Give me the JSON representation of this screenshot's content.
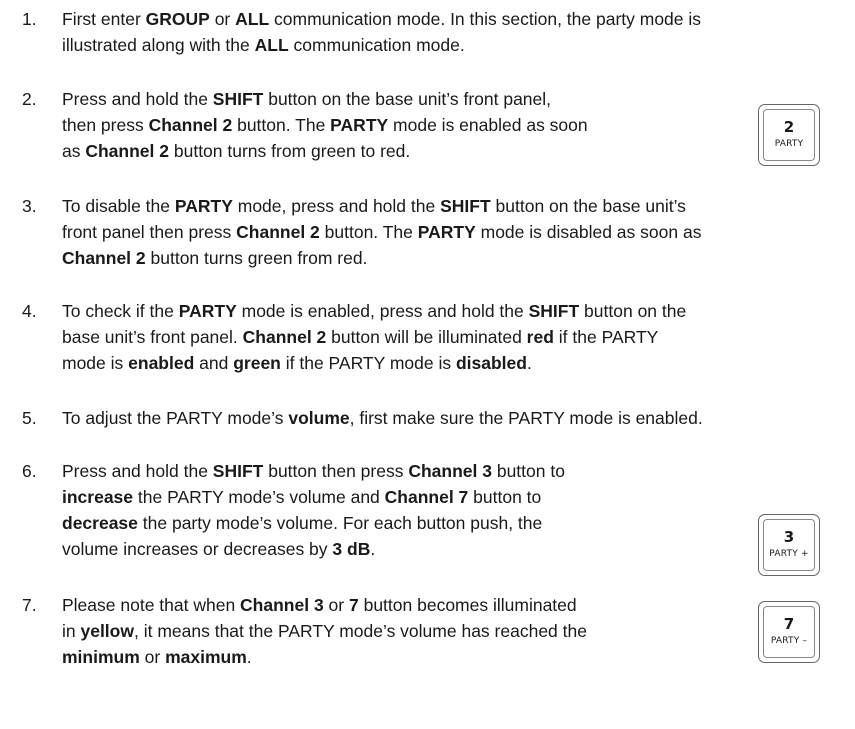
{
  "steps": [
    {
      "number": "1.",
      "lines": [
        [
          {
            "t": "First enter "
          },
          {
            "t": "GROUP",
            "b": true
          },
          {
            "t": " or "
          },
          {
            "t": "ALL",
            "b": true
          },
          {
            "t": " communication mode. In this section, the party mode is"
          }
        ],
        [
          {
            "t": "illustrated along with the "
          },
          {
            "t": "ALL",
            "b": true
          },
          {
            "t": " communication mode."
          }
        ]
      ]
    },
    {
      "number": "2.",
      "lines": [
        [
          {
            "t": "Press and hold the "
          },
          {
            "t": "SHIFT",
            "b": true
          },
          {
            "t": " button on the base unit’s front panel,"
          }
        ],
        [
          {
            "t": "then press "
          },
          {
            "t": "Channel 2",
            "b": true
          },
          {
            "t": " button. The "
          },
          {
            "t": "PARTY",
            "b": true
          },
          {
            "t": " mode is enabled as soon"
          }
        ],
        [
          {
            "t": "as "
          },
          {
            "t": "Channel 2",
            "b": true
          },
          {
            "t": " button turns from green to red."
          }
        ]
      ]
    },
    {
      "number": "3.",
      "lines": [
        [
          {
            "t": "To disable the "
          },
          {
            "t": "PARTY",
            "b": true
          },
          {
            "t": " mode, press and hold the "
          },
          {
            "t": "SHIFT",
            "b": true
          },
          {
            "t": " button on the base unit’s"
          }
        ],
        [
          {
            "t": "front panel then press "
          },
          {
            "t": "Channel 2",
            "b": true
          },
          {
            "t": " button. The "
          },
          {
            "t": "PARTY",
            "b": true
          },
          {
            "t": " mode is disabled as soon as"
          }
        ],
        [
          {
            "t": "Channel 2",
            "b": true
          },
          {
            "t": " button turns green from red."
          }
        ]
      ]
    },
    {
      "number": "4.",
      "lines": [
        [
          {
            "t": "To check if the "
          },
          {
            "t": "PARTY",
            "b": true
          },
          {
            "t": " mode is enabled, press and hold the "
          },
          {
            "t": "SHIFT",
            "b": true
          },
          {
            "t": " button on the"
          }
        ],
        [
          {
            "t": "base unit’s front panel. "
          },
          {
            "t": "Channel 2",
            "b": true
          },
          {
            "t": " button will be illuminated "
          },
          {
            "t": "red",
            "b": true
          },
          {
            "t": " if the PARTY"
          }
        ],
        [
          {
            "t": "mode is "
          },
          {
            "t": "enabled",
            "b": true
          },
          {
            "t": " and "
          },
          {
            "t": "green",
            "b": true
          },
          {
            "t": " if the PARTY mode is "
          },
          {
            "t": "disabled",
            "b": true
          },
          {
            "t": "."
          }
        ]
      ]
    },
    {
      "number": "5.",
      "lines": [
        [
          {
            "t": "To adjust the PARTY mode’s "
          },
          {
            "t": "volume",
            "b": true
          },
          {
            "t": ", first make sure the PARTY mode is enabled."
          }
        ]
      ]
    },
    {
      "number": "6.",
      "lines": [
        [
          {
            "t": "Press and hold the "
          },
          {
            "t": "SHIFT",
            "b": true
          },
          {
            "t": " button then press "
          },
          {
            "t": "Channel 3",
            "b": true
          },
          {
            "t": " button to"
          }
        ],
        [
          {
            "t": "increase",
            "b": true
          },
          {
            "t": " the PARTY mode’s volume and "
          },
          {
            "t": "Channel 7",
            "b": true
          },
          {
            "t": " button to"
          }
        ],
        [
          {
            "t": "decrease",
            "b": true
          },
          {
            "t": " the party mode’s volume. For each button push, the"
          }
        ],
        [
          {
            "t": "volume increases or decreases by "
          },
          {
            "t": "3 dB",
            "b": true
          },
          {
            "t": "."
          }
        ]
      ]
    },
    {
      "number": "7.",
      "lines": [
        [
          {
            "t": "Please note that when "
          },
          {
            "t": "Channel 3",
            "b": true
          },
          {
            "t": " or "
          },
          {
            "t": "7",
            "b": true
          },
          {
            "t": " button becomes illuminated"
          }
        ],
        [
          {
            "t": "in "
          },
          {
            "t": "yellow",
            "b": true
          },
          {
            "t": ", it means that the PARTY mode’s volume has reached the"
          }
        ],
        [
          {
            "t": "minimum",
            "b": true
          },
          {
            "t": " or "
          },
          {
            "t": "maximum",
            "b": true
          },
          {
            "t": "."
          }
        ]
      ]
    }
  ],
  "keys": [
    {
      "number": "2",
      "label": "PARTY"
    },
    {
      "number": "3",
      "label": "PARTY +"
    },
    {
      "number": "7",
      "label": "PARTY –"
    }
  ]
}
